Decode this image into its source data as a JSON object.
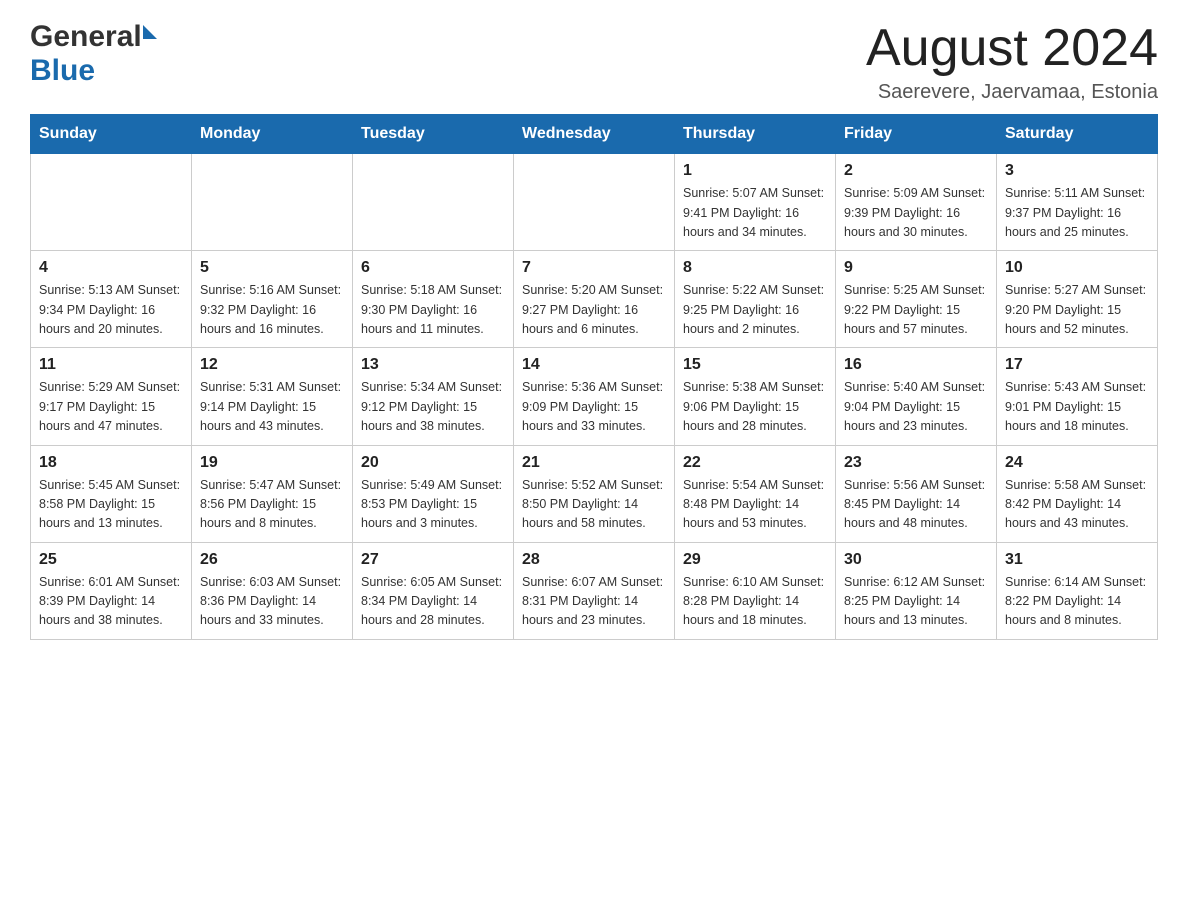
{
  "header": {
    "month_title": "August 2024",
    "location": "Saerevere, Jaervamaa, Estonia"
  },
  "logo": {
    "general": "General",
    "blue": "Blue"
  },
  "weekdays": [
    "Sunday",
    "Monday",
    "Tuesday",
    "Wednesday",
    "Thursday",
    "Friday",
    "Saturday"
  ],
  "weeks": [
    [
      {
        "day": "",
        "info": ""
      },
      {
        "day": "",
        "info": ""
      },
      {
        "day": "",
        "info": ""
      },
      {
        "day": "",
        "info": ""
      },
      {
        "day": "1",
        "info": "Sunrise: 5:07 AM\nSunset: 9:41 PM\nDaylight: 16 hours\nand 34 minutes."
      },
      {
        "day": "2",
        "info": "Sunrise: 5:09 AM\nSunset: 9:39 PM\nDaylight: 16 hours\nand 30 minutes."
      },
      {
        "day": "3",
        "info": "Sunrise: 5:11 AM\nSunset: 9:37 PM\nDaylight: 16 hours\nand 25 minutes."
      }
    ],
    [
      {
        "day": "4",
        "info": "Sunrise: 5:13 AM\nSunset: 9:34 PM\nDaylight: 16 hours\nand 20 minutes."
      },
      {
        "day": "5",
        "info": "Sunrise: 5:16 AM\nSunset: 9:32 PM\nDaylight: 16 hours\nand 16 minutes."
      },
      {
        "day": "6",
        "info": "Sunrise: 5:18 AM\nSunset: 9:30 PM\nDaylight: 16 hours\nand 11 minutes."
      },
      {
        "day": "7",
        "info": "Sunrise: 5:20 AM\nSunset: 9:27 PM\nDaylight: 16 hours\nand 6 minutes."
      },
      {
        "day": "8",
        "info": "Sunrise: 5:22 AM\nSunset: 9:25 PM\nDaylight: 16 hours\nand 2 minutes."
      },
      {
        "day": "9",
        "info": "Sunrise: 5:25 AM\nSunset: 9:22 PM\nDaylight: 15 hours\nand 57 minutes."
      },
      {
        "day": "10",
        "info": "Sunrise: 5:27 AM\nSunset: 9:20 PM\nDaylight: 15 hours\nand 52 minutes."
      }
    ],
    [
      {
        "day": "11",
        "info": "Sunrise: 5:29 AM\nSunset: 9:17 PM\nDaylight: 15 hours\nand 47 minutes."
      },
      {
        "day": "12",
        "info": "Sunrise: 5:31 AM\nSunset: 9:14 PM\nDaylight: 15 hours\nand 43 minutes."
      },
      {
        "day": "13",
        "info": "Sunrise: 5:34 AM\nSunset: 9:12 PM\nDaylight: 15 hours\nand 38 minutes."
      },
      {
        "day": "14",
        "info": "Sunrise: 5:36 AM\nSunset: 9:09 PM\nDaylight: 15 hours\nand 33 minutes."
      },
      {
        "day": "15",
        "info": "Sunrise: 5:38 AM\nSunset: 9:06 PM\nDaylight: 15 hours\nand 28 minutes."
      },
      {
        "day": "16",
        "info": "Sunrise: 5:40 AM\nSunset: 9:04 PM\nDaylight: 15 hours\nand 23 minutes."
      },
      {
        "day": "17",
        "info": "Sunrise: 5:43 AM\nSunset: 9:01 PM\nDaylight: 15 hours\nand 18 minutes."
      }
    ],
    [
      {
        "day": "18",
        "info": "Sunrise: 5:45 AM\nSunset: 8:58 PM\nDaylight: 15 hours\nand 13 minutes."
      },
      {
        "day": "19",
        "info": "Sunrise: 5:47 AM\nSunset: 8:56 PM\nDaylight: 15 hours\nand 8 minutes."
      },
      {
        "day": "20",
        "info": "Sunrise: 5:49 AM\nSunset: 8:53 PM\nDaylight: 15 hours\nand 3 minutes."
      },
      {
        "day": "21",
        "info": "Sunrise: 5:52 AM\nSunset: 8:50 PM\nDaylight: 14 hours\nand 58 minutes."
      },
      {
        "day": "22",
        "info": "Sunrise: 5:54 AM\nSunset: 8:48 PM\nDaylight: 14 hours\nand 53 minutes."
      },
      {
        "day": "23",
        "info": "Sunrise: 5:56 AM\nSunset: 8:45 PM\nDaylight: 14 hours\nand 48 minutes."
      },
      {
        "day": "24",
        "info": "Sunrise: 5:58 AM\nSunset: 8:42 PM\nDaylight: 14 hours\nand 43 minutes."
      }
    ],
    [
      {
        "day": "25",
        "info": "Sunrise: 6:01 AM\nSunset: 8:39 PM\nDaylight: 14 hours\nand 38 minutes."
      },
      {
        "day": "26",
        "info": "Sunrise: 6:03 AM\nSunset: 8:36 PM\nDaylight: 14 hours\nand 33 minutes."
      },
      {
        "day": "27",
        "info": "Sunrise: 6:05 AM\nSunset: 8:34 PM\nDaylight: 14 hours\nand 28 minutes."
      },
      {
        "day": "28",
        "info": "Sunrise: 6:07 AM\nSunset: 8:31 PM\nDaylight: 14 hours\nand 23 minutes."
      },
      {
        "day": "29",
        "info": "Sunrise: 6:10 AM\nSunset: 8:28 PM\nDaylight: 14 hours\nand 18 minutes."
      },
      {
        "day": "30",
        "info": "Sunrise: 6:12 AM\nSunset: 8:25 PM\nDaylight: 14 hours\nand 13 minutes."
      },
      {
        "day": "31",
        "info": "Sunrise: 6:14 AM\nSunset: 8:22 PM\nDaylight: 14 hours\nand 8 minutes."
      }
    ]
  ]
}
